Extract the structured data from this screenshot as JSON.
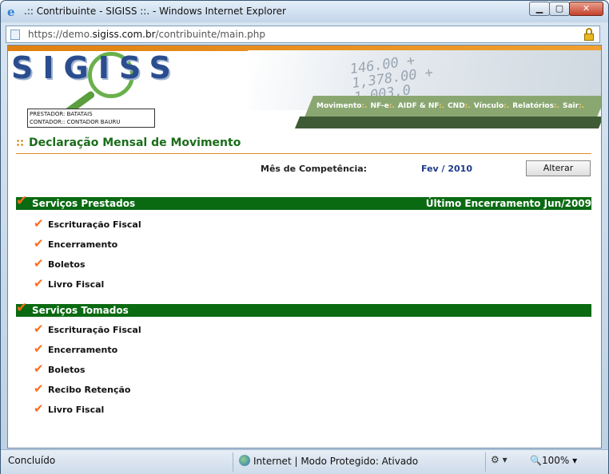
{
  "window": {
    "title": ".:: Contribuinte - SIGISS ::. - Windows Internet Explorer",
    "min_label": "▁",
    "max_label": "▢",
    "close_label": "✕"
  },
  "address": {
    "prefix": "https://demo.",
    "domain": "sigiss.com.br",
    "path": "/contribuinte/main.php"
  },
  "banner": {
    "logo": "SIGISS",
    "decorative_digits": "146.00 +\n1,378.00 +\n1,003.0",
    "info_line1": "PRESTADOR: BATATAIS",
    "info_line2": "CONTADOR:: CONTADOR BAURU"
  },
  "nav": {
    "items": [
      {
        "label": "Movimento"
      },
      {
        "label": "NF-e"
      },
      {
        "label": "AIDF & NF"
      },
      {
        "label": "CND"
      },
      {
        "label": "Vínculo"
      },
      {
        "label": "Relatórios"
      },
      {
        "label": "Sair"
      }
    ],
    "separator": ":."
  },
  "main": {
    "heading": "Declaração Mensal de Movimento",
    "competencia_label": "Mês de Competência:",
    "competencia_value": "Fev / 2010",
    "alter_button": "Alterar",
    "sections": [
      {
        "title": "Serviços Prestados",
        "right": "Último Encerramento Jun/2009",
        "items": [
          "Escrituração Fiscal",
          "Encerramento",
          "Boletos",
          "Livro Fiscal"
        ]
      },
      {
        "title": "Serviços Tomados",
        "right": "",
        "items": [
          "Escrituração Fiscal",
          "Encerramento",
          "Boletos",
          "Recibo Retenção",
          "Livro Fiscal"
        ]
      }
    ]
  },
  "status": {
    "left": "Concluído",
    "zone": "Internet | Modo Protegido: Ativado",
    "zoom": "100%"
  },
  "colors": {
    "section_bar": "#0a6a12",
    "heading": "#1b6d1b",
    "check": "#ff6a1a",
    "nav_bg": "#8aa772"
  }
}
